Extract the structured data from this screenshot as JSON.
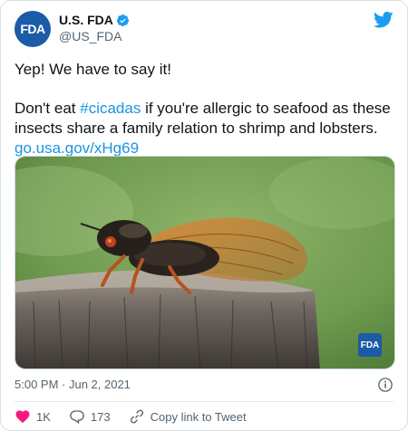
{
  "author": {
    "avatar_text": "FDA",
    "display_name": "U.S. FDA",
    "handle": "@US_FDA"
  },
  "tweet": {
    "line1": "Yep! We have to say it!",
    "p2_before": "Don't eat ",
    "hashtag": "#cicadas",
    "p2_after": " if you're allergic to seafood as these insects share a family relation to shrimp and lobsters.",
    "link": "go.usa.gov/xHg69"
  },
  "media": {
    "badge": "FDA"
  },
  "meta": {
    "timestamp": "5:00 PM · Jun 2, 2021"
  },
  "actions": {
    "likes": "1K",
    "replies": "173",
    "copy_link": "Copy link to Tweet"
  },
  "colors": {
    "brand": "#1b5ba7",
    "link": "#1b95e0",
    "twitter": "#1d9bf0",
    "like": "#f91880"
  }
}
